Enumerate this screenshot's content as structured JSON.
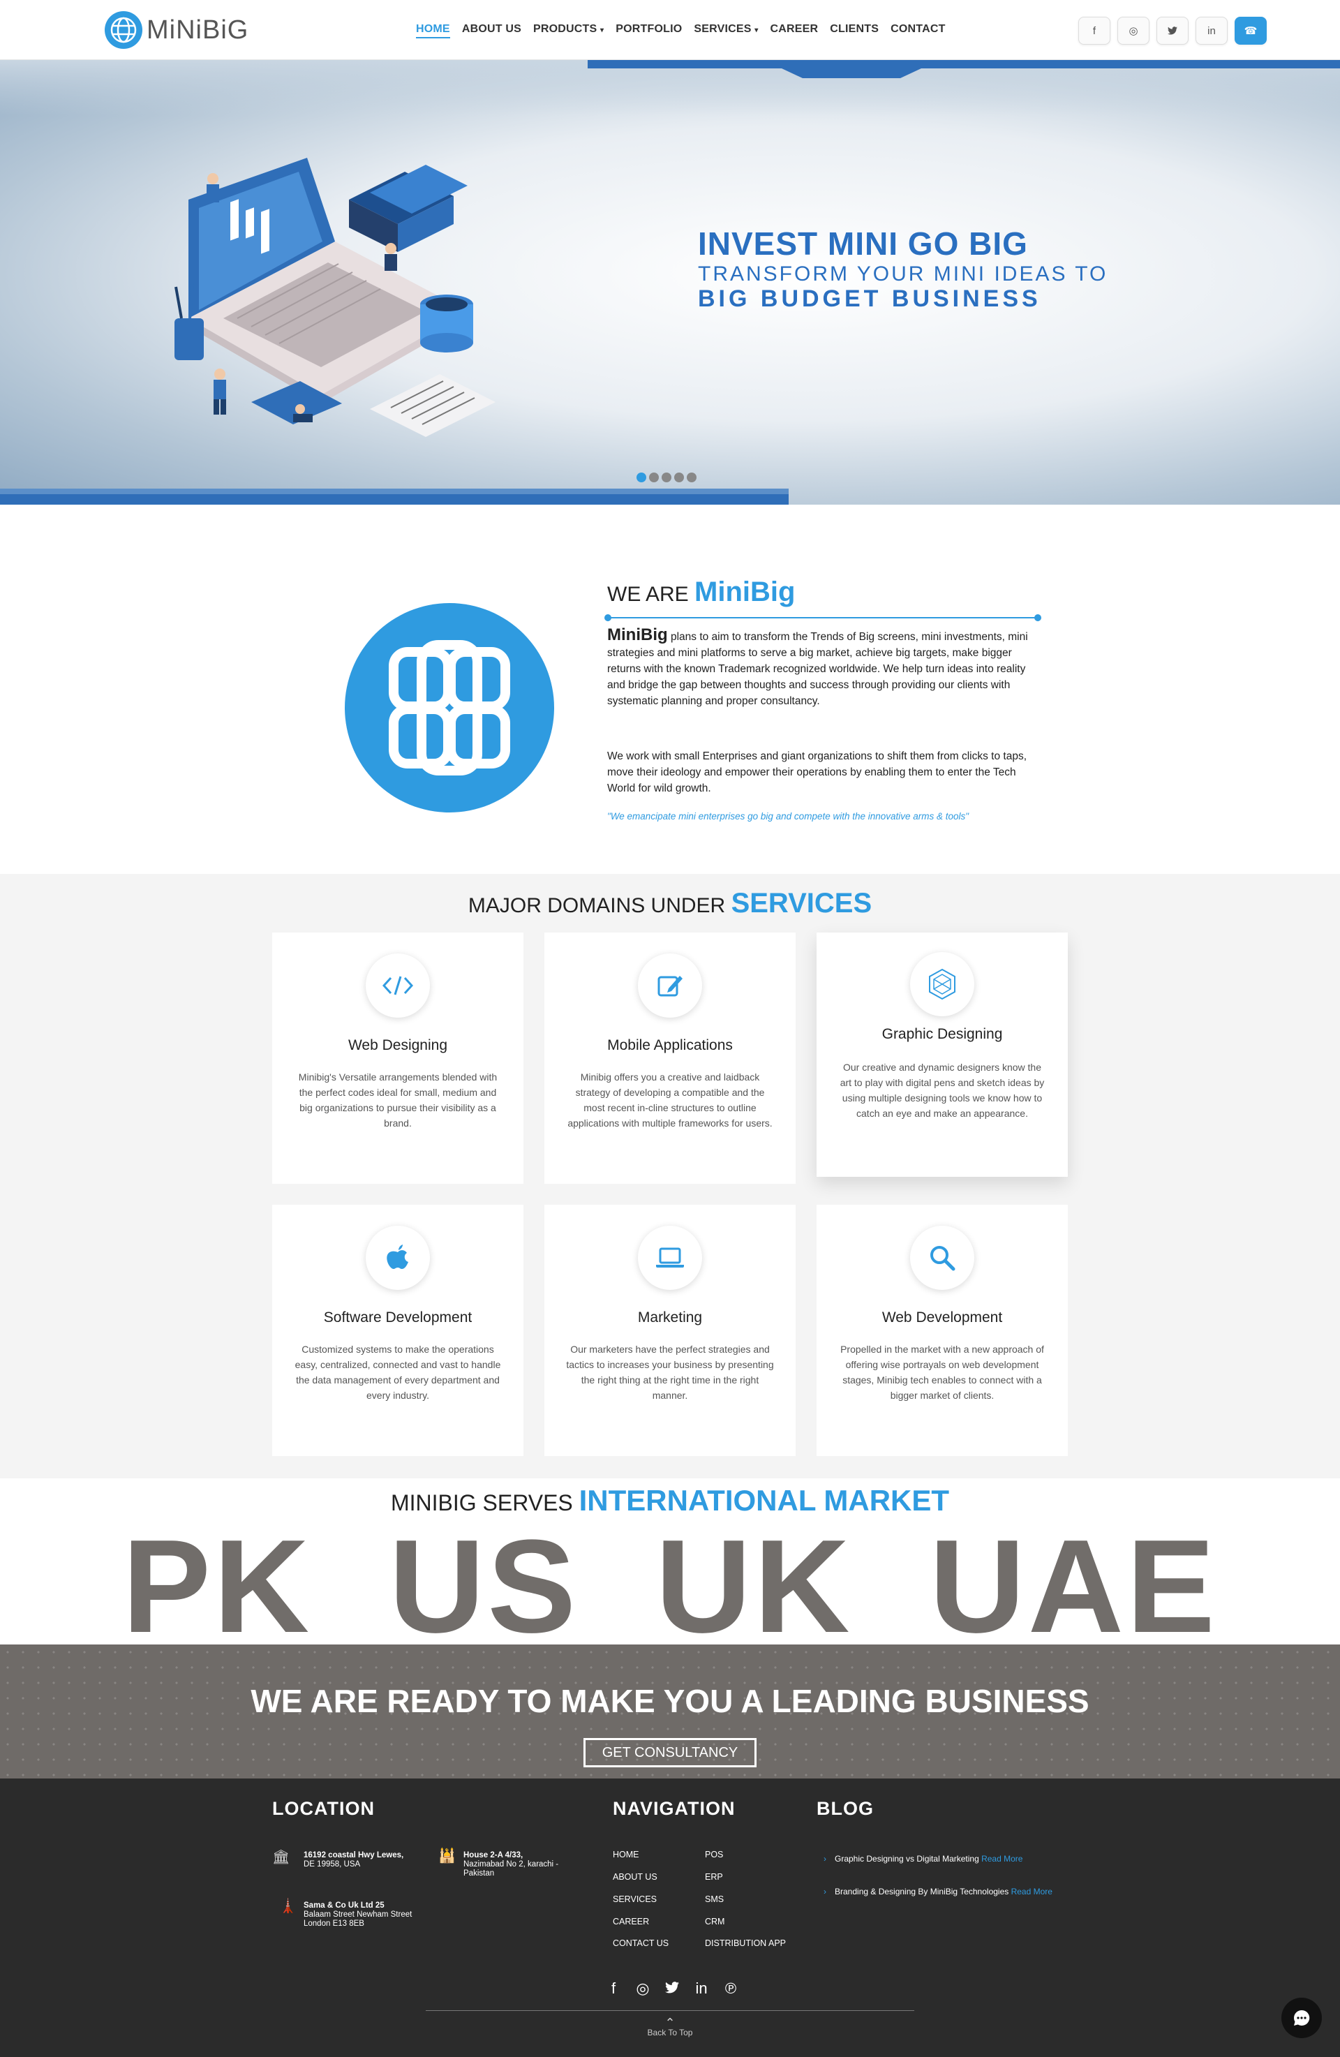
{
  "brand": {
    "name": "MiNiBiG",
    "accent": "#2f9be0",
    "dark_blue": "#2a6fc0"
  },
  "nav": {
    "items": [
      {
        "label": "HOME",
        "active": true,
        "caret": ""
      },
      {
        "label": "ABOUT US",
        "active": false,
        "caret": ""
      },
      {
        "label": "PRODUCTS",
        "active": false,
        "caret": "▾"
      },
      {
        "label": "PORTFOLIO",
        "active": false,
        "caret": ""
      },
      {
        "label": "SERVICES",
        "active": false,
        "caret": "▾"
      },
      {
        "label": "CAREER",
        "active": false,
        "caret": ""
      },
      {
        "label": "CLIENTS",
        "active": false,
        "caret": ""
      },
      {
        "label": "CONTACT",
        "active": false,
        "caret": ""
      }
    ],
    "socials": [
      {
        "name": "facebook-icon",
        "glyph": "f"
      },
      {
        "name": "instagram-icon",
        "glyph": "◎"
      },
      {
        "name": "twitter-icon",
        "glyph": "🐦"
      },
      {
        "name": "linkedin-icon",
        "glyph": "in"
      },
      {
        "name": "phone-icon",
        "glyph": "☎"
      }
    ]
  },
  "hero": {
    "line1": "INVEST MINI GO BIG",
    "line2": "TRANSFORM YOUR MINI IDEAS TO",
    "line3": "BIG BUDGET BUSINESS",
    "slides": 5,
    "active_slide": 1
  },
  "about": {
    "title_prefix": "WE ARE",
    "title_brand": "MiniBig",
    "p1_lead": "MiniBig",
    "p1": " plans to aim to transform the Trends of Big screens, mini investments, mini strategies and mini platforms to serve a big market, achieve big targets, make bigger returns with the known Trademark recognized worldwide. We help turn ideas into reality and bridge the gap between thoughts and success through providing our clients with systematic planning and proper consultancy.",
    "p2": "We work with small Enterprises and giant organizations to shift them from clicks to taps, move their ideology and empower their operations by enabling them to enter the Tech World for wild growth.",
    "quote": "\"We emancipate mini enterprises go big and compete with the innovative arms & tools\""
  },
  "services": {
    "title_prefix": "MAJOR DOMAINS UNDER",
    "title_hl": "SERVICES",
    "cards": [
      {
        "title": "Web Designing",
        "icon": "code-icon",
        "text": "Minibig's Versatile arrangements blended with the perfect codes ideal for small, medium and big organizations to pursue their visibility as a brand."
      },
      {
        "title": "Mobile Applications",
        "icon": "edit-icon",
        "text": "Minibig offers you a creative and laidback strategy of developing a compatible and the most recent in-cline structures to outline applications with multiple frameworks for users."
      },
      {
        "title": "Graphic Designing",
        "icon": "hexagon-icon",
        "text": "Our creative and dynamic designers know the art to play with digital pens and sketch ideas by using multiple designing tools we know how to catch an eye and make an appearance."
      },
      {
        "title": "Software Development",
        "icon": "apple-icon",
        "text": "Customized systems to make the operations easy, centralized, connected and vast to handle the data management of every department and every industry."
      },
      {
        "title": "Marketing",
        "icon": "laptop-icon",
        "text": "Our marketers have the perfect strategies and tactics to increases your business by presenting the right thing at the right time in the right manner."
      },
      {
        "title": "Web Development",
        "icon": "search-icon",
        "text": "Propelled in the market with a new approach of offering wise portrayals on web development stages, Minibig tech enables to connect with a bigger market of clients."
      }
    ]
  },
  "market": {
    "title_prefix": "MINIBIG SERVES",
    "title_hl": "INTERNATIONAL MARKET",
    "codes": [
      "PK",
      "US",
      "UK",
      "UAE"
    ],
    "cta_heading": "WE ARE READY TO MAKE YOU A LEADING BUSINESS",
    "cta_button": "GET CONSULTANCY"
  },
  "footer": {
    "location_title": "LOCATION",
    "navigation_title": "NAVIGATION",
    "blog_title": "BLOG",
    "addresses": [
      {
        "l1": "16192 coastal Hwy Lewes,",
        "l2": "DE 19958, USA",
        "l3": ""
      },
      {
        "l1": "House 2-A 4/33,",
        "l2": "Nazimabad No 2, karachi -",
        "l3": "Pakistan"
      },
      {
        "l1": "Sama & Co Uk Ltd 25",
        "l2": "Balaam Street Newham Street",
        "l3": "London E13 8EB"
      }
    ],
    "nav_col1": [
      "HOME",
      "ABOUT US",
      "SERVICES",
      "CAREER",
      "CONTACT US"
    ],
    "nav_col2": [
      "POS",
      "ERP",
      "SMS",
      "CRM",
      "DISTRIBUTION APP"
    ],
    "blog": [
      {
        "text": "Graphic Designing vs Digital Marketing ",
        "more": "Read More"
      },
      {
        "text": "Branding & Designing By MiniBig Technologies ",
        "more": "Read More"
      }
    ],
    "back_to_top": "Back To Top"
  }
}
